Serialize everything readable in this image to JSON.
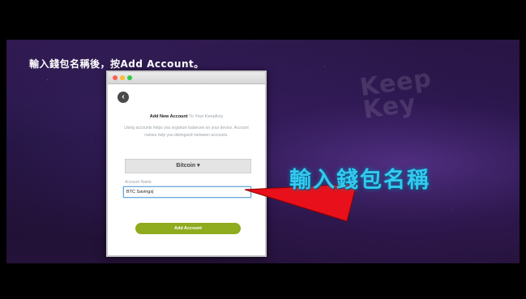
{
  "caption": "輸入錢包名稱後，按Add Account。",
  "callout": "輸入錢包名稱",
  "watermark": "Keep\nKey",
  "window": {
    "heading_bold": "Add New Account",
    "heading_rest": " To Your KeepKey",
    "description": "Using accounts helps you organize balances on your device. Account names help you distinguish between accounts.",
    "coin_select": "Bitcoin ▾",
    "account_name_label": "Account Name",
    "account_name_value": "BTC Savings|",
    "add_button": "Add Account"
  },
  "colors": {
    "callout": "#34c9f0",
    "arrow": "#e8101a",
    "add_button": "#8fab1e"
  }
}
